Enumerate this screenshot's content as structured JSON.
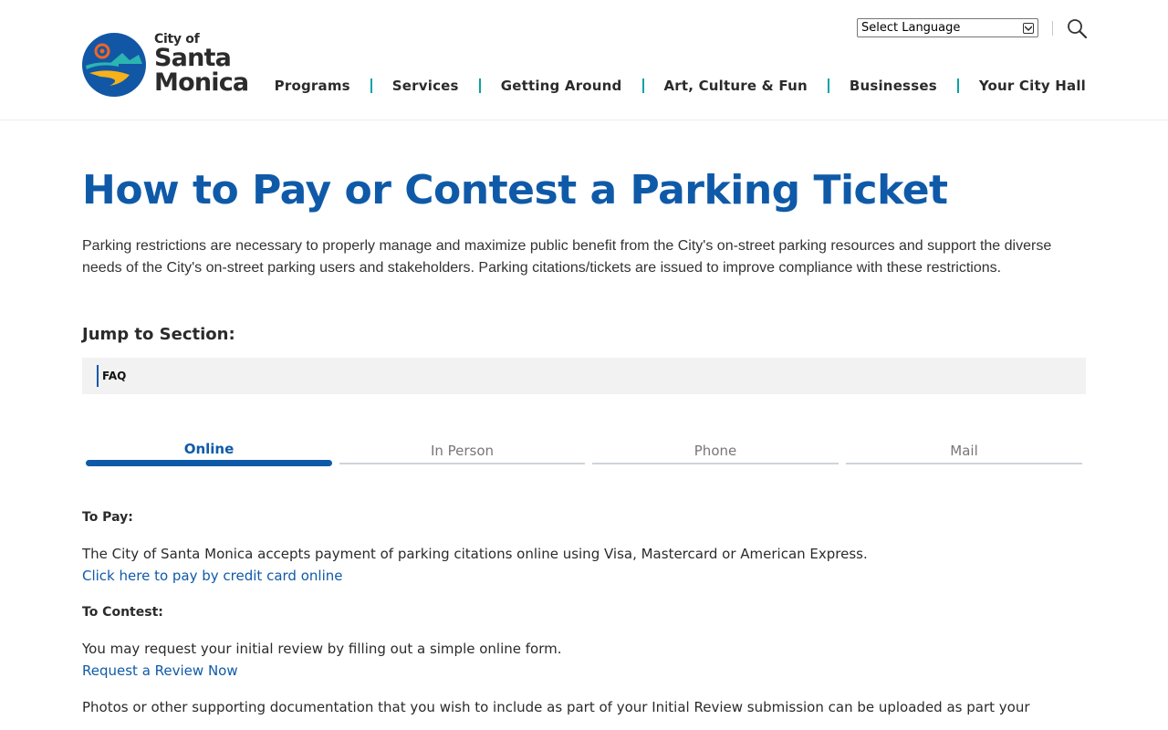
{
  "header": {
    "logo": {
      "line1": "City of",
      "line2": "Santa",
      "line3": "Monica"
    },
    "language_select": "Select Language",
    "nav": [
      {
        "label": "Programs"
      },
      {
        "label": "Services"
      },
      {
        "label": "Getting Around"
      },
      {
        "label": "Art, Culture & Fun"
      },
      {
        "label": "Businesses"
      },
      {
        "label": "Your City Hall"
      }
    ]
  },
  "main": {
    "title": "How to Pay or Contest a Parking Ticket",
    "intro": "Parking restrictions are necessary to properly manage and maximize public benefit from the City's on-street parking resources and support the diverse needs of the City's on-street parking users and stakeholders. Parking citations/tickets are issued to improve compliance with these restrictions.",
    "jump_heading": "Jump to Section:",
    "jump_links": [
      {
        "label": "FAQ"
      }
    ],
    "tabs": [
      {
        "label": "Online",
        "active": true
      },
      {
        "label": "In Person",
        "active": false
      },
      {
        "label": "Phone",
        "active": false
      },
      {
        "label": "Mail",
        "active": false
      }
    ],
    "content": {
      "pay_heading": "To Pay:",
      "pay_text": "The City of Santa Monica accepts payment of parking citations online using Visa, Mastercard or American Express.",
      "pay_link": "Click here to pay by credit card online",
      "contest_heading": "To Contest:",
      "contest_text": "You may request your initial review by filling out a simple online form.",
      "contest_link": "Request a Review Now",
      "photos_text": "Photos or other supporting documentation that you wish to include as part of your Initial Review submission can be uploaded as part your"
    }
  },
  "colors": {
    "brand_blue": "#0f5aa8",
    "nav_separator": "#0aa3a3",
    "logo_orange": "#f26522",
    "logo_yellow": "#f5b21b",
    "logo_teal": "#2bb5b0"
  }
}
